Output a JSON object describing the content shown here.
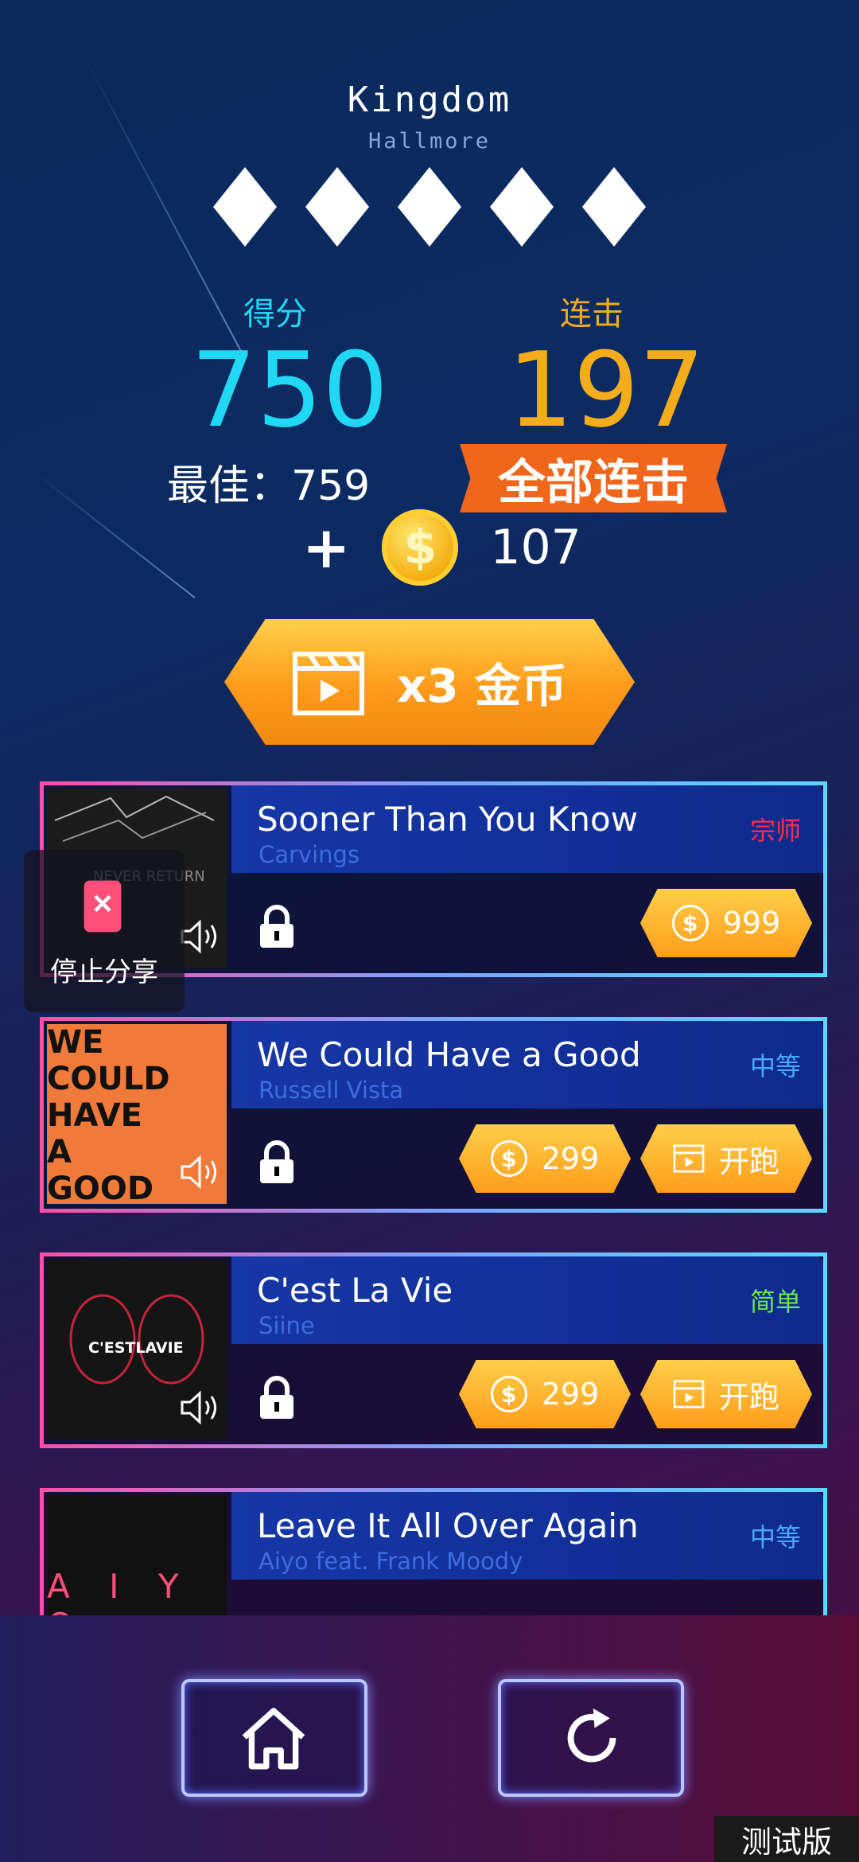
{
  "song": {
    "title": "Kingdom",
    "artist": "Hallmore"
  },
  "rating": {
    "diamonds": 5
  },
  "score": {
    "label": "得分",
    "value": "750",
    "best_text": "最佳：759"
  },
  "combo": {
    "label": "连击",
    "value": "197",
    "badge": "全部连击"
  },
  "reward": {
    "plus": "+",
    "coin_symbol": "$",
    "amount": "107"
  },
  "ad_button": {
    "label": "x3 金币",
    "icon": "clapperboard-icon"
  },
  "share_overlay": {
    "label": "停止分享",
    "icon": "phone-stop-icon"
  },
  "songs": [
    {
      "title": "Sooner Than You Know",
      "artist": "Carvings",
      "difficulty": "宗师",
      "difficulty_color": "#ff2d55",
      "price": "999",
      "play_label": "",
      "art_text": "never return"
    },
    {
      "title": "We Could Have a Good",
      "artist": "Russell Vista",
      "difficulty": "中等",
      "difficulty_color": "#4aa8ff",
      "price": "299",
      "play_label": "开跑",
      "art_text": "WE COULD HAVE A GOOD TIME"
    },
    {
      "title": "C'est La Vie",
      "artist": "Siine",
      "difficulty": "简单",
      "difficulty_color": "#6bea4e",
      "price": "299",
      "play_label": "开跑",
      "art_text": "C'ESTLAVIE"
    },
    {
      "title": "Leave It All Over Again",
      "artist": "Aiyo feat. Frank Moody",
      "difficulty": "中等",
      "difficulty_color": "#4aa8ff",
      "price": "",
      "play_label": "",
      "art_text": "A I Y O"
    }
  ],
  "nav": {
    "home_icon": "home-icon",
    "replay_icon": "replay-icon"
  },
  "build_tag": "测试版",
  "colors": {
    "score": "#21d8f4",
    "combo": "#f4ad1a",
    "badge": "#f0661b",
    "button_orange": "#ff9d1c"
  }
}
